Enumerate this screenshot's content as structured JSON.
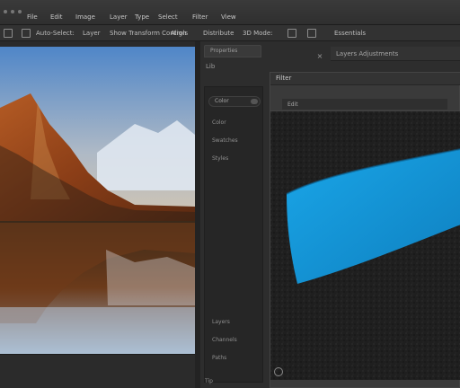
{
  "menubar": {
    "items": [
      "File",
      "Edit",
      "Image",
      "Layer",
      "Type",
      "Select",
      "Filter",
      "View"
    ],
    "dots": 3
  },
  "optbar": {
    "items": [
      "Auto-Select:",
      "Layer",
      "Show Transform Controls",
      "Align",
      "Distribute",
      "3D Mode:"
    ],
    "tool_label": "Essentials"
  },
  "panel": {
    "tab_label": "Properties",
    "right_tab_label": "Layers Adjustments",
    "sub_label": "Lib",
    "preview_header": "Filter",
    "preview_sub": "Edit"
  },
  "sidebar": {
    "segment_label": "Color",
    "items": [
      "Color",
      "Swatches",
      "Styles",
      "Layers",
      "Channels",
      "Paths"
    ]
  },
  "bottom": {
    "label": "Tip"
  },
  "colors": {
    "accent_blue": "#2aa9e6",
    "panel_bg": "#2d2d2d"
  }
}
